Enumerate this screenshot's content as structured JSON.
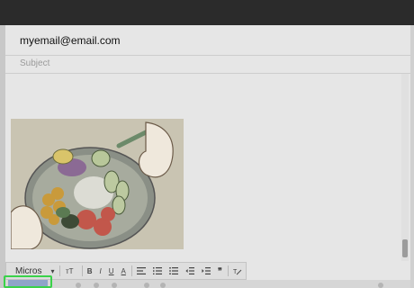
{
  "compose": {
    "to_value": "myemail@email.com",
    "subject_placeholder": "Subject"
  },
  "format_toolbar": {
    "font_label": "Micros",
    "size_icon": "text-size-icon",
    "bold": "B",
    "italic": "I",
    "underline": "U",
    "text_color": "A",
    "quote": "❞"
  },
  "colors": {
    "accent_highlight": "#3ad24a",
    "send_button": "#8fa4c9",
    "title_bar": "#2b2b2b"
  }
}
